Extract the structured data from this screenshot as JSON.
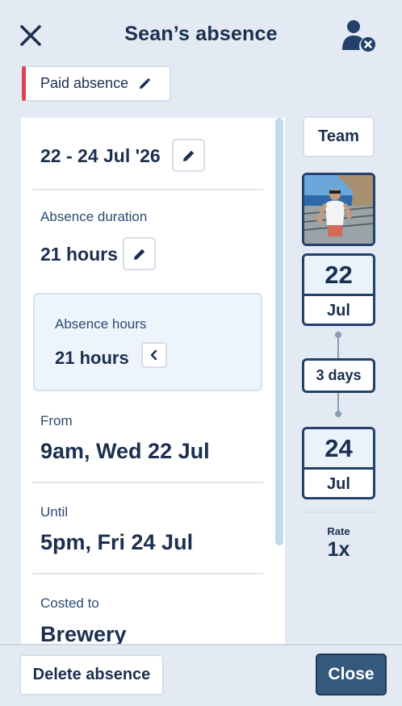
{
  "header": {
    "title": "Sean’s absence"
  },
  "absence_type": {
    "label": "Paid absence",
    "color": "#e0424f"
  },
  "details": {
    "date_range": "22 - 24 Jul '26",
    "duration_label": "Absence duration",
    "duration_value": "21 hours",
    "hours_label": "Absence hours",
    "hours_value": "21 hours",
    "from_label": "From",
    "from_value": "9am, Wed 22 Jul",
    "until_label": "Until",
    "until_value": "5pm, Fri 24 Jul",
    "costed_label": "Costed to",
    "costed_value": "Brewery"
  },
  "sidebar": {
    "team_label": "Team",
    "start_day": "22",
    "start_month": "Jul",
    "span_label": "3 days",
    "end_day": "24",
    "end_month": "Jul",
    "rate_label": "Rate",
    "rate_value": "1x"
  },
  "footer": {
    "delete_label": "Delete absence",
    "close_label": "Close"
  },
  "icons": {
    "close": "close-icon",
    "remove_user": "remove-user-icon",
    "edit": "pencil-icon",
    "collapse": "chevron-left-icon"
  },
  "colors": {
    "background": "#e3eaf4",
    "primary_text": "#1b2f4f",
    "close_button": "#34597d"
  }
}
